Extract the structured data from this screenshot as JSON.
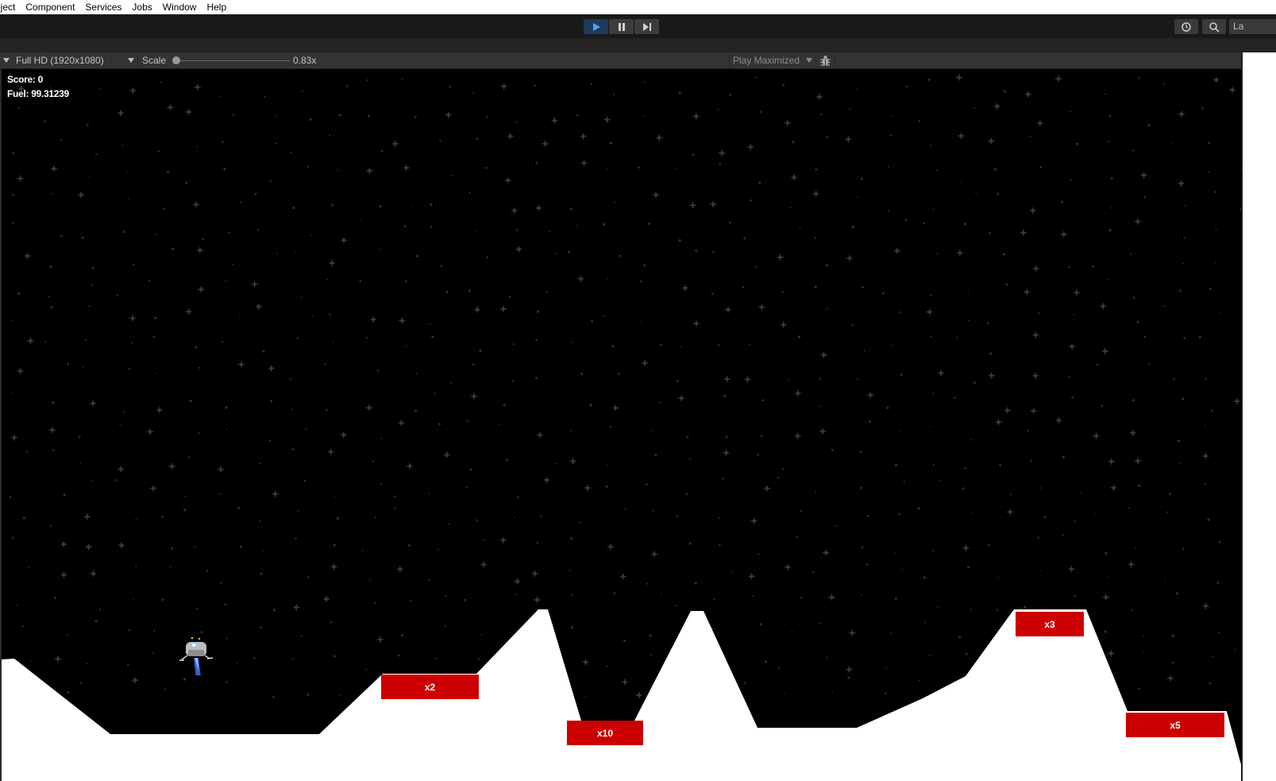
{
  "menu": {
    "items": [
      "bject",
      "Component",
      "Services",
      "Jobs",
      "Window",
      "Help"
    ]
  },
  "toolbar": {
    "play_icon": "play-icon",
    "pause_icon": "pause-icon",
    "step_icon": "step-icon",
    "history_icon": "history-icon",
    "search_icon": "search-icon",
    "layout_label": "La",
    "active_color": "#1e3a5c"
  },
  "game_view": {
    "resolution": "Full HD (1920x1080)",
    "scale_label": "Scale",
    "scale_value": "0.83x",
    "play_mode": "Play Maximized",
    "bug_icon": "bug-icon"
  },
  "hud": {
    "score_label": "Score",
    "score_value": "0",
    "fuel_label": "Fuel",
    "fuel_value": "99.31239"
  },
  "pads": [
    {
      "label": "x2"
    },
    {
      "label": "x10"
    },
    {
      "label": "x3"
    },
    {
      "label": "x5"
    }
  ],
  "colors": {
    "pad": "#cc0000",
    "terrain": "#ffffff",
    "sky": "#000000"
  },
  "ship": {
    "icon": "lander-ship-icon",
    "thrust": "on"
  }
}
